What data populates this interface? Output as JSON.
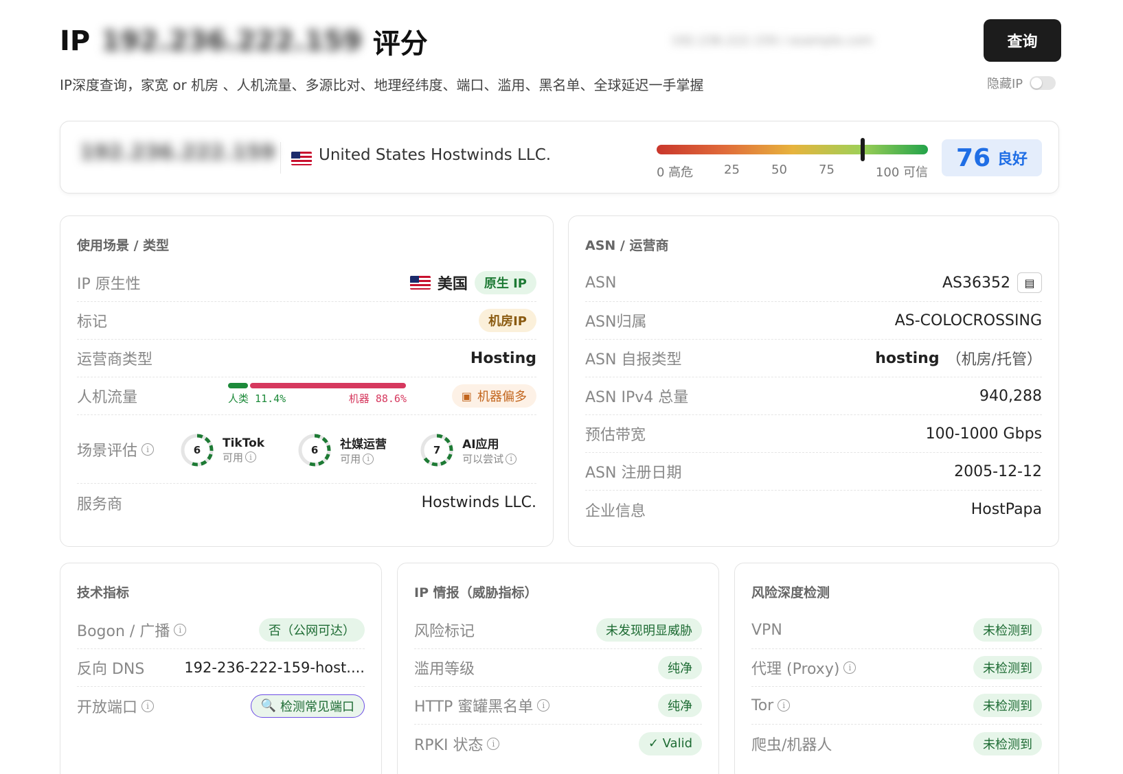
{
  "header": {
    "title_prefix": "IP",
    "title_ip": "192.236.222.159",
    "title_suffix": "评分",
    "subtitle": "IP深度查询，家宽 or 机房 、人机流量、多源比对、地理经纬度、端口、滥用、黑名单、全球延迟一手掌握",
    "query_placeholder": "192.236.222.159 / example.com",
    "query_button": "查询",
    "hide_ip_label": "隐藏IP"
  },
  "score_card": {
    "ip": "192.236.222.159",
    "org": "United States Hostwinds LLC.",
    "scale_labels": [
      "0 高危",
      "25",
      "50",
      "75",
      "100 可信"
    ],
    "score": "76",
    "score_label": "良好",
    "score_fraction": 0.76,
    "colors": {
      "score_bg": "#e4edfb",
      "score_text": "#1f6ee5"
    }
  },
  "usage": {
    "title": "使用场景 / 类型",
    "native": {
      "label": "IP 原生性",
      "country": "美国",
      "badge": "原生 IP"
    },
    "tag": {
      "label": "标记",
      "badge": "机房IP"
    },
    "carrier": {
      "label": "运营商类型",
      "value": "Hosting"
    },
    "traffic": {
      "label": "人机流量",
      "human_label": "人类",
      "human_value": "11.4%",
      "bot_label": "机器",
      "bot_value": "88.6%",
      "human_fraction": 0.114,
      "badge": "机器偏多"
    },
    "scene": {
      "label": "场景评估",
      "items": [
        {
          "name": "TikTok",
          "score": "6",
          "status": "可用"
        },
        {
          "name": "社媒运营",
          "score": "6",
          "status": "可用"
        },
        {
          "name": "AI应用",
          "score": "7",
          "status": "可以尝试"
        }
      ]
    },
    "provider": {
      "label": "服务商",
      "value": "Hostwinds LLC."
    }
  },
  "asn": {
    "title": "ASN / 运营商",
    "asn": {
      "label": "ASN",
      "value": "AS36352"
    },
    "owner": {
      "label": "ASN归属",
      "value": "AS-COLOCROSSING"
    },
    "type": {
      "label": "ASN 自报类型",
      "value": "hosting",
      "note": "（机房/托管）"
    },
    "ipv4": {
      "label": "ASN IPv4 总量",
      "value": "940,288"
    },
    "bandwidth": {
      "label": "预估带宽",
      "value": "100-1000 Gbps"
    },
    "reg_date": {
      "label": "ASN 注册日期",
      "value": "2005-12-12"
    },
    "company": {
      "label": "企业信息",
      "value": "HostPapa"
    }
  },
  "tech": {
    "title": "技术指标",
    "bogon": {
      "label": "Bogon / 广播",
      "badge": "否（公网可达）"
    },
    "rdns": {
      "label": "反向 DNS",
      "value": "192-236-222-159-host...."
    },
    "ports": {
      "label": "开放端口",
      "button": "检测常见端口"
    }
  },
  "intel": {
    "title": "IP 情报（威胁指标）",
    "risk": {
      "label": "风险标记",
      "badge": "未发现明显威胁"
    },
    "abuse": {
      "label": "滥用等级",
      "badge": "纯净"
    },
    "honeypot": {
      "label": "HTTP 蜜罐黑名单",
      "badge": "纯净"
    },
    "rpki": {
      "label": "RPKI 状态",
      "badge": "✓ Valid"
    }
  },
  "risk": {
    "title": "风险深度检测",
    "vpn": {
      "label": "VPN",
      "badge": "未检测到"
    },
    "proxy": {
      "label": "代理 (Proxy)",
      "badge": "未检测到"
    },
    "tor": {
      "label": "Tor",
      "badge": "未检测到"
    },
    "crawler": {
      "label": "爬虫/机器人",
      "badge": "未检测到"
    }
  }
}
